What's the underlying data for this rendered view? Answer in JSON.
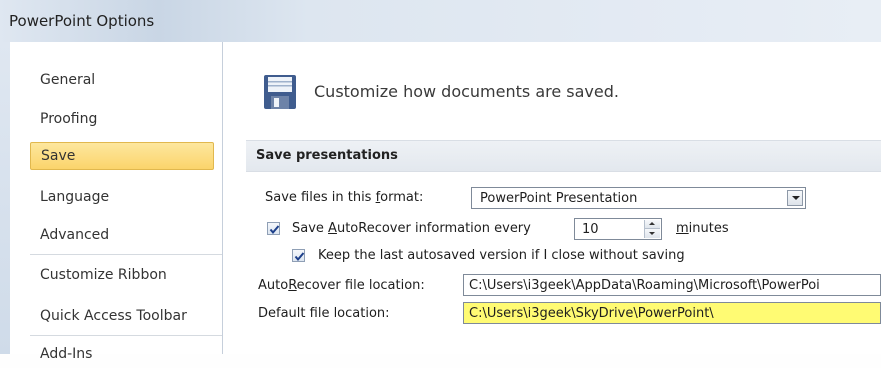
{
  "window": {
    "title": "PowerPoint Options"
  },
  "sidebar": {
    "items": [
      {
        "label": "General"
      },
      {
        "label": "Proofing"
      },
      {
        "label": "Save",
        "selected": true
      },
      {
        "label": "Language"
      },
      {
        "label": "Advanced"
      },
      {
        "label": "Customize Ribbon"
      },
      {
        "label": "Quick Access Toolbar"
      },
      {
        "label": "Add-Ins"
      }
    ]
  },
  "header": {
    "text": "Customize how documents are saved.",
    "icon": "floppy-disk-icon"
  },
  "section": {
    "title": "Save presentations"
  },
  "format": {
    "label_pre": "Save files in this ",
    "label_key": "f",
    "label_post": "ormat:",
    "value": "PowerPoint Presentation"
  },
  "autorecover": {
    "checked": true,
    "label_pre": "Save ",
    "label_key": "A",
    "label_post": "utoRecover information every",
    "minutes_value": "10",
    "minutes_key": "m",
    "minutes_post": "inutes"
  },
  "keep_last": {
    "checked": true,
    "label": "Keep the last autosaved version if I close without saving"
  },
  "autorecover_location": {
    "label_pre": "Auto",
    "label_key": "R",
    "label_post": "ecover file location:",
    "value": "C:\\Users\\i3geek\\AppData\\Roaming\\Microsoft\\PowerPoi"
  },
  "default_location": {
    "label_pre": "Default f",
    "label_key": "i",
    "label_post": "le location:",
    "value": "C:\\Users\\i3geek\\SkyDrive\\PowerPoint\\",
    "highlight_color": "#fffb73"
  },
  "colors": {
    "selected_nav": "#fbd46b",
    "section_header": "#e6eaef",
    "floppy": "#3f5c8e"
  }
}
